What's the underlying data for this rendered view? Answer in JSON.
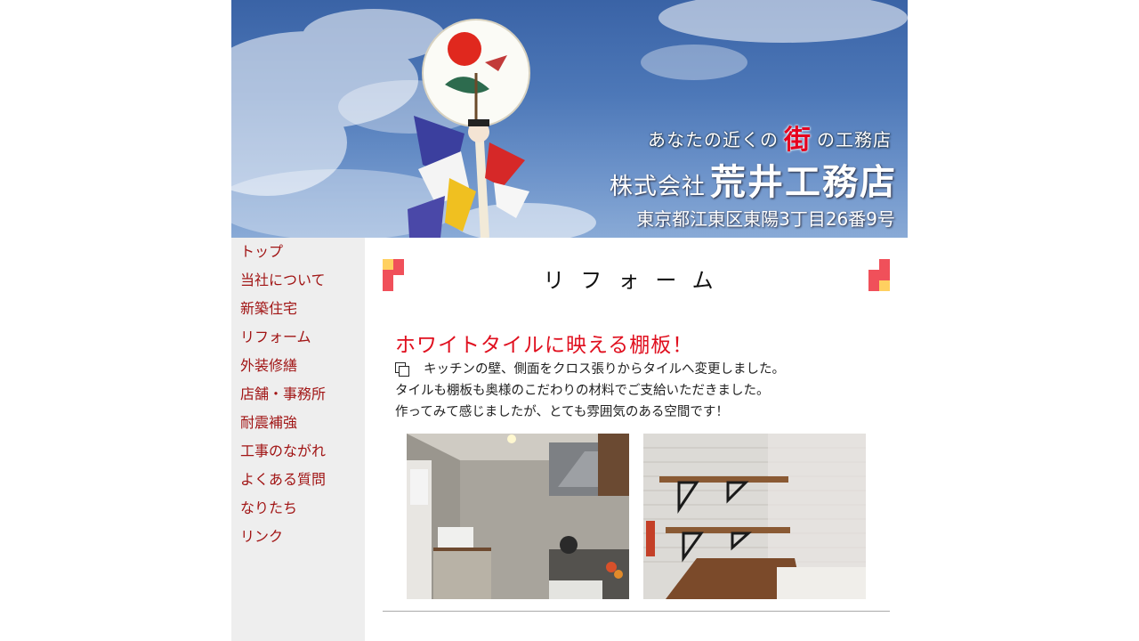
{
  "header": {
    "tagline_before": "あなたの近くの",
    "tagline_accent": "街",
    "tagline_after": "の工務店",
    "company_kind": "株式会社",
    "company_name": "荒井工務店",
    "address": "東京都江東区東陽3丁目26番9号"
  },
  "sidebar": {
    "items": [
      {
        "label": "トップ"
      },
      {
        "label": "当社について"
      },
      {
        "label": "新築住宅"
      },
      {
        "label": "リフォーム"
      },
      {
        "label": "外装修繕"
      },
      {
        "label": "店舗・事務所"
      },
      {
        "label": "耐震補強"
      },
      {
        "label": "工事のながれ"
      },
      {
        "label": "よくある質問"
      },
      {
        "label": "なりたち"
      },
      {
        "label": "リンク"
      }
    ]
  },
  "main": {
    "page_title": "リフォーム",
    "article": {
      "heading": "ホワイトタイルに映える棚板！",
      "lines": [
        "キッチンの壁、側面をクロス張りからタイルへ変更しました。",
        "タイルも棚板も奥様のこだわりの材料でご支給いただきました。",
        "作ってみて感じましたが、とても雰囲気のある空間です！"
      ]
    }
  },
  "colors": {
    "nav_link": "#a11515",
    "heading": "#e0101f",
    "sidebar_bg": "#eeeeee",
    "deco_red": "#f0505a",
    "deco_yellow": "#ffd060"
  },
  "icons": {
    "article_bullet": "copy-icon"
  }
}
